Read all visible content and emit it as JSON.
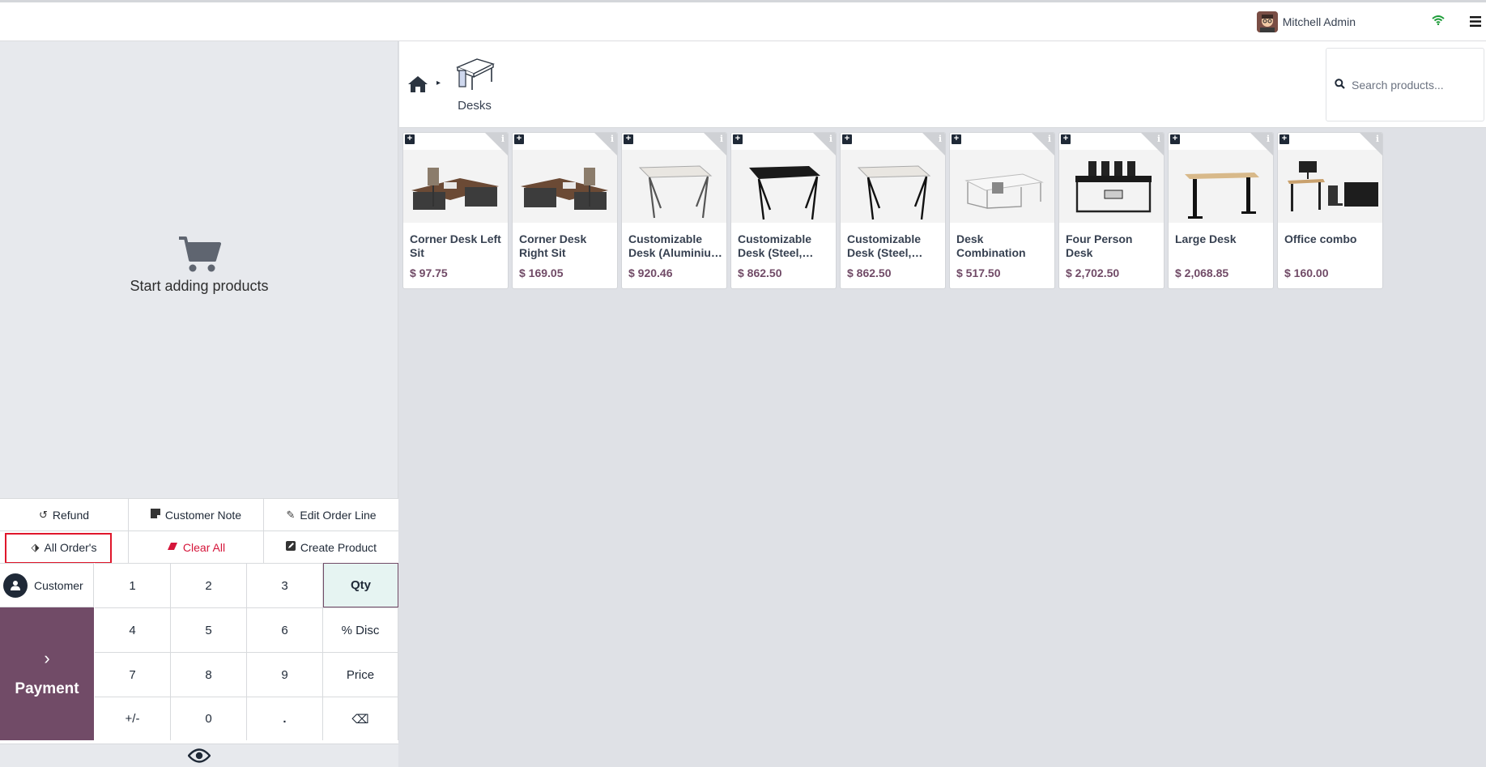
{
  "header": {
    "user_name": "Mitchell Admin",
    "icons": [
      "avatar",
      "wifi-icon",
      "hamburger-menu-icon"
    ]
  },
  "order": {
    "empty_message": "Start adding products"
  },
  "actions": {
    "refund": "Refund",
    "customer_note": "Customer Note",
    "edit_order_line": "Edit Order Line",
    "all_orders": "All Order's",
    "clear_all": "Clear All",
    "create_product": "Create Product"
  },
  "numpad": {
    "customer": "Customer",
    "payment": "Payment",
    "keys": [
      "1",
      "2",
      "3",
      "Qty",
      "4",
      "5",
      "6",
      "% Disc",
      "7",
      "8",
      "9",
      "Price",
      "+/-",
      "0",
      ".",
      "⌫"
    ]
  },
  "category": {
    "current": "Desks"
  },
  "search": {
    "placeholder": "Search products..."
  },
  "products": [
    {
      "name": "Corner Desk Left Sit",
      "price": "$ 97.75"
    },
    {
      "name": "Corner Desk Right Sit",
      "price": "$ 169.05"
    },
    {
      "name": "Customizable Desk (Aluminiu…",
      "price": "$ 920.46"
    },
    {
      "name": "Customizable Desk (Steel,…",
      "price": "$ 862.50"
    },
    {
      "name": "Customizable Desk (Steel,…",
      "price": "$ 862.50"
    },
    {
      "name": "Desk Combination",
      "price": "$ 517.50"
    },
    {
      "name": "Four Person Desk",
      "price": "$ 2,702.50"
    },
    {
      "name": "Large Desk",
      "price": "$ 2,068.85"
    },
    {
      "name": "Office combo",
      "price": "$ 160.00"
    }
  ],
  "colors": {
    "brand": "#714b67",
    "danger": "#d5153a",
    "qty_active_bg": "#e6f4f2"
  }
}
